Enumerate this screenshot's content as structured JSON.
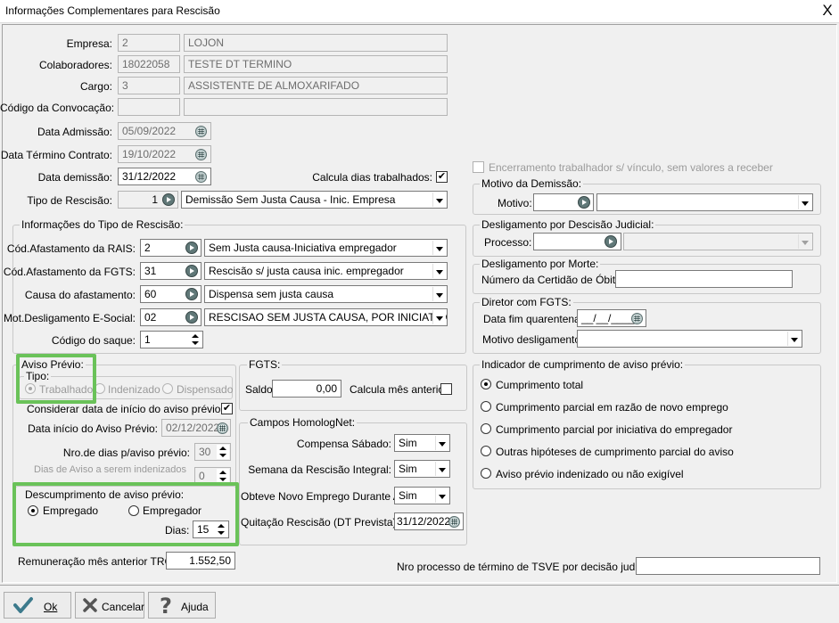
{
  "window": {
    "title": "Informações Complementares para Rescisão",
    "close": "X"
  },
  "main": {
    "empresa_label": "Empresa:",
    "empresa_code": "2",
    "empresa_name": "LOJON",
    "colab_label": "Colaboradores:",
    "colab_code": "18022058",
    "colab_name": "TESTE DT TERMINO",
    "cargo_label": "Cargo:",
    "cargo_code": "3",
    "cargo_name": "ASSISTENTE DE ALMOXARIFADO",
    "convocacao_label": "Código da Convocação:",
    "convocacao_code": "",
    "convocacao_name": "",
    "admissao_label": "Data Admissão:",
    "admissao_value": "05/09/2022",
    "termino_label": "Data Término Contrato:",
    "termino_value": "19/10/2022",
    "demissao_label": "Data demissão:",
    "demissao_value": "31/12/2022",
    "calcula_dias_label": "Calcula dias trabalhados:",
    "calcula_dias_checked": true,
    "tipo_rescisao_label": "Tipo de Rescisão:",
    "tipo_rescisao_code": "1",
    "tipo_rescisao_value": "Demissão Sem Justa Causa - Inic. Empresa"
  },
  "info_tipo": {
    "title": "Informações do Tipo de Rescisão:",
    "rais_label": "Cód.Afastamento da RAIS:",
    "rais_code": "2",
    "rais_value": "Sem Justa causa-Iniciativa empregador",
    "fgts_label": "Cód.Afastamento da FGTS:",
    "fgts_code": "31",
    "fgts_value": "Rescisão s/ justa causa inic. empregador",
    "causa_label": "Causa do afastamento:",
    "causa_code": "60",
    "causa_value": "Dispensa sem justa causa",
    "esocial_label": "Mot.Desligamento E-Social:",
    "esocial_code": "02",
    "esocial_value": "RESCISAO SEM JUSTA CAUSA, POR INICIATIVA DO",
    "saque_label": "Código do saque:",
    "saque_value": "1"
  },
  "aviso": {
    "title": "Aviso Prévio:",
    "tipo_title": "Tipo:",
    "tipo_options": [
      "Trabalhado",
      "Indenizado",
      "Dispensado"
    ],
    "tipo_selected": "Trabalhado",
    "considerar_label": "Considerar data de início do aviso prévio:",
    "considerar_checked": true,
    "inicio_label": "Data início do Aviso Prévio:",
    "inicio_value": "02/12/2022",
    "nro_dias_label": "Nro.de dias p/aviso prévio:",
    "nro_dias_value": "30",
    "indenizados_label": "Dias de Aviso a serem indenizados pelo Empregador:",
    "indenizados_value": "0"
  },
  "descumprimento": {
    "title": "Descumprimento de aviso prévio:",
    "opt1": "Empregado",
    "opt2": "Empregador",
    "selected": "Empregado",
    "dias_label": "Dias:",
    "dias_value": "15"
  },
  "remuneracao": {
    "label": "Remuneração mês anterior TRCT:",
    "value": "1.552,50"
  },
  "fgts": {
    "title": "FGTS:",
    "saldo_label": "Saldo:",
    "saldo_value": "0,00",
    "calc_label": "Calcula mês anterior:",
    "calc_checked": false
  },
  "homolognet": {
    "title": "Campos HomologNet:",
    "compensa_label": "Compensa Sábado:",
    "compensa_value": "Sim",
    "semana_label": "Semana da Rescisão Integral:",
    "semana_value": "Sim",
    "novo_emprego_label": "Obteve Novo Emprego Durante API:",
    "novo_emprego_value": "Sim",
    "quitacao_label": "Quitação Rescisão (DT Prevista):",
    "quitacao_value": "31/12/2022"
  },
  "right": {
    "encerramento_label": "Encerramento trabalhador s/ vínculo, sem valores a receber",
    "motivo_demissao_title": "Motivo da Demissão:",
    "motivo_label": "Motivo:",
    "motivo_code": "",
    "motivo_value": "",
    "judicial_title": "Desligamento por Descisão Judicial:",
    "processo_label": "Processo:",
    "processo_value": "",
    "morte_title": "Desligamento por Morte:",
    "certidao_label": "Número da Certidão de  Óbito:",
    "certidao_value": "",
    "diretor_title": "Diretor com FGTS:",
    "quarentena_label": "Data fim quarentena:",
    "quarentena_value": "__/__/____",
    "motivo_desl_label": "Motivo desligamento:",
    "motivo_desl_value": "",
    "indicador_title": "Indicador de cumprimento de aviso prévio:",
    "indicador_options": [
      "Cumprimento total",
      "Cumprimento parcial em razão de novo emprego",
      "Cumprimento parcial por iniciativa do empregador",
      "Outras hipóteses de cumprimento parcial do aviso",
      "Aviso prévio indenizado ou não exigível"
    ],
    "indicador_selected": "Cumprimento total"
  },
  "tsve": {
    "label": "Nro processo de término de TSVE por decisão judicial:",
    "value": ""
  },
  "buttons": {
    "ok": "Ok",
    "cancelar": "Cancelar",
    "ajuda": "Ajuda"
  },
  "colors": {
    "highlight": "#6ac259",
    "window_bg": "#f0f0f0",
    "ok_check": "#3c7a8c",
    "x_icon": "#555555"
  }
}
